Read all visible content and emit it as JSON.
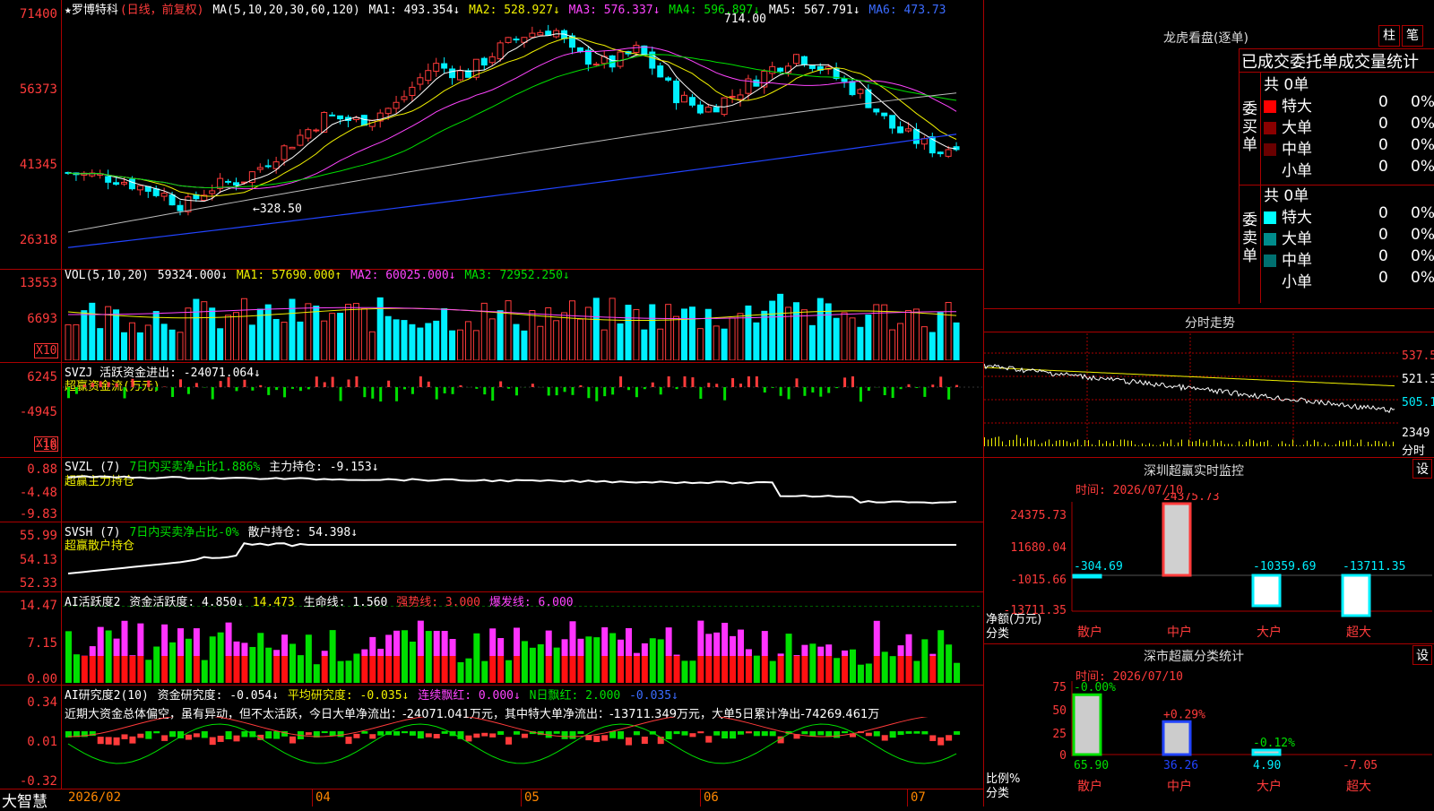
{
  "stock": {
    "name": "★罗博特科",
    "mode": "(日线，前复权)"
  },
  "main_header": {
    "ma_label": "MA(5,10,20,30,60,120)",
    "ma1": "MA1: 493.354↓",
    "ma2": "MA2: 528.927↓",
    "ma3": "MA3: 576.337↓",
    "ma4": "MA4: 596.897↓",
    "ma5": "MA5: 567.791↓",
    "ma6": "MA6: 473.73"
  },
  "main_axis": [
    "71400",
    "56373",
    "41345",
    "26318"
  ],
  "annotations": {
    "high": "714.00",
    "low": "←328.50"
  },
  "vol": {
    "header": "VOL(5,10,20)",
    "val": "59324.000↓",
    "ma1": "MA1: 57690.000↑",
    "ma2": "MA2: 60025.000↓",
    "ma3": "MA3: 72952.250↓",
    "axis": [
      "13553",
      "6693"
    ],
    "unit": "X10"
  },
  "svzj": {
    "header": "SVZJ  活跃资金进出: -24071.064↓",
    "sub": "超赢资金流(万元)",
    "axis": [
      "6245",
      "-4945",
      "-16"
    ],
    "unit": "X10"
  },
  "svzl": {
    "h1": "SVZL (7)",
    "h2": "7日内买卖净占比1.886%",
    "h3": "主力持仓: -9.153↓",
    "sub": "超赢主力持仓",
    "axis": [
      "0.88",
      "-4.48",
      "-9.83"
    ]
  },
  "svsh": {
    "h1": "SVSH (7)",
    "h2": "7日内买卖净占比-0%",
    "h3": "散户持仓: 54.398↓",
    "sub": "超赢散户持仓",
    "axis": [
      "55.99",
      "54.13",
      "52.33"
    ]
  },
  "ai1": {
    "h1": "AI活跃度2",
    "h2": "资金活跃度: 4.850↓",
    "h3": "14.473",
    "h4": "生命线: 1.560",
    "h5": "强势线: 3.000",
    "h6": "爆发线: 6.000",
    "axis": [
      "14.47",
      "7.15",
      "0.00"
    ]
  },
  "ai2": {
    "h1": "AI研究度2(10)",
    "h2": "资金研究度: -0.054↓",
    "h3": "平均研究度: -0.035↓",
    "h4": "连续飘红: 0.000↓",
    "h5": "N日飘红: 2.000",
    "h6": "-0.035↓",
    "note": "近期大资金总体偏空，虽有异动，但不太活跃，今日大单净流出：-24071.041万元，其中特大单净流出：-13711.349万元，大单5日累计净出-74269.461万",
    "axis": [
      "0.34",
      "0.01",
      "-0.32"
    ]
  },
  "xaxis": [
    "2026/02",
    "04",
    "05",
    "06",
    "07"
  ],
  "brand": "大智慧",
  "right": {
    "dragon_title": "龙虎看盘(逐单)",
    "btn_bar": "柱",
    "btn_tick": "笔",
    "tabs": "已成交委托单成交量统计",
    "buy_label": "委买单",
    "sell_label": "委卖单",
    "buy_total": "共 0单",
    "sell_total": "共 0单",
    "rows": [
      {
        "label": "特大",
        "count": "0",
        "pct": "0%"
      },
      {
        "label": "大单",
        "count": "0",
        "pct": "0%"
      },
      {
        "label": "中单",
        "count": "0",
        "pct": "0%"
      },
      {
        "label": "小单",
        "count": "0",
        "pct": "0%"
      }
    ],
    "buy_colors": [
      "#ff0000",
      "#8b0000",
      "#6a0000",
      "#000"
    ],
    "sell_colors": [
      "#00ffff",
      "#008b8b",
      "#007070",
      "#000"
    ],
    "fenshi_title": "分时走势",
    "fenshi_axis": [
      "537.5",
      "521.3",
      "505.1",
      "2349"
    ],
    "fenshi_unit": "分时",
    "monitor_title": "深圳超赢实时监控",
    "monitor_btn": "设",
    "time_label": "时间: 2026/07/10",
    "monitor_axis": [
      "24375.73",
      "11680.04",
      "-1015.66",
      "-13711.35"
    ],
    "net_label": "净额(万元)",
    "cls_label": "分类",
    "bars": [
      {
        "cat": "散户",
        "val": "-304.69"
      },
      {
        "cat": "中户",
        "val": "24375.73"
      },
      {
        "cat": "大户",
        "val": "-10359.69"
      },
      {
        "cat": "超大",
        "val": "-13711.35"
      }
    ],
    "stat_title": "深市超赢分类统计",
    "stat_btn": "设",
    "stat_time": "时间: 2026/07/10",
    "stat_axis": [
      "75",
      "50",
      "25",
      "0"
    ],
    "ratio_label": "比例%",
    "stat_cls_label": "分类",
    "stat_bars": [
      {
        "cat": "散户",
        "top": "-0.00%",
        "bottom": "65.90"
      },
      {
        "cat": "中户",
        "top": "+0.29%",
        "bottom": "36.26"
      },
      {
        "cat": "大户",
        "top": "-0.12%",
        "bottom": "4.90"
      },
      {
        "cat": "超大",
        "top": "",
        "bottom": "-7.05"
      }
    ]
  }
}
